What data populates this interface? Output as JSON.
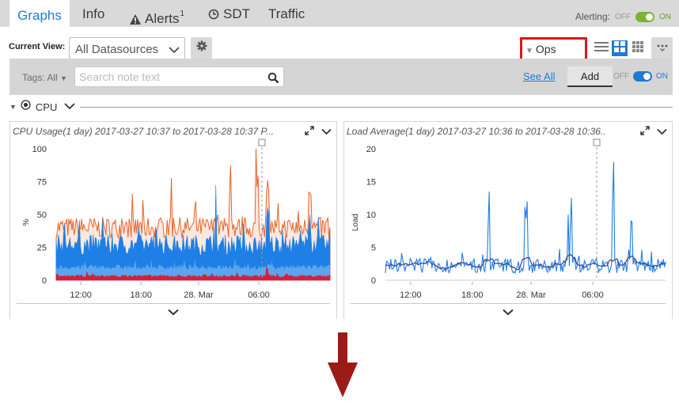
{
  "tabs": [
    {
      "label": "Graphs",
      "active": true
    },
    {
      "label": "Info"
    },
    {
      "label": "Alerts",
      "badge": "1",
      "icon": "warning-icon"
    },
    {
      "label": "SDT",
      "icon": "sdt-clock-icon"
    },
    {
      "label": "Traffic"
    }
  ],
  "alerting": {
    "label": "Alerting:",
    "off": "OFF",
    "on": "ON",
    "state": "on"
  },
  "view": {
    "label": "Current View:",
    "selected": "All Datasources",
    "ops_notes_label": "Ops Notes"
  },
  "notes": {
    "tags_label": "Tags: All",
    "search_placeholder": "Search note text",
    "see_all": "See All",
    "add": "Add",
    "off": "OFF",
    "on": "ON"
  },
  "group": {
    "label": "CPU"
  },
  "colors": {
    "accent": "#1f7ad8",
    "highlight": "#e0151b",
    "series_orange": "#e8632a",
    "series_blue": "#1e7fe6",
    "series_lightblue": "#5aa5ee",
    "series_red": "#d3203a",
    "series_navy": "#3b3f8f",
    "arrow": "#9b1c16"
  },
  "chart_data": [
    {
      "type": "area",
      "title": "CPU Usage(1 day) 2017-03-27 10:37 to 2017-03-28 10:37 P...",
      "ylabel": "%",
      "ylim": [
        0,
        100
      ],
      "yticks": [
        "100",
        "75",
        "50",
        "25",
        "0"
      ],
      "xticks": [
        "12:00",
        "18:00",
        "28. Mar",
        "06:00"
      ],
      "series": [
        {
          "color": "#e8632a",
          "description": "upper envelope, 35-50 typical, spikes to 100 around 18:00-22:00 and 05:00"
        },
        {
          "color": "#1e7fe6",
          "description": "main band ~15-40"
        },
        {
          "color": "#5aa5ee",
          "description": "baseline ~10"
        },
        {
          "color": "#d3203a",
          "description": "floor ~3"
        }
      ]
    },
    {
      "type": "line",
      "title": "Load Average(1 day) 2017-03-27 10:36 to 2017-03-28 10:36..",
      "ylabel": "Load",
      "ylim": [
        0,
        20
      ],
      "yticks": [
        "20",
        "15",
        "10",
        "5",
        "0"
      ],
      "xticks": [
        "12:00",
        "18:00",
        "28. Mar",
        "06:00"
      ],
      "series": [
        {
          "color": "#1e7fe6",
          "description": "1-min load, ~2 typical, spikes 13-18"
        },
        {
          "color": "#3b3f8f",
          "description": "smoothed load ~1-3"
        }
      ]
    }
  ]
}
